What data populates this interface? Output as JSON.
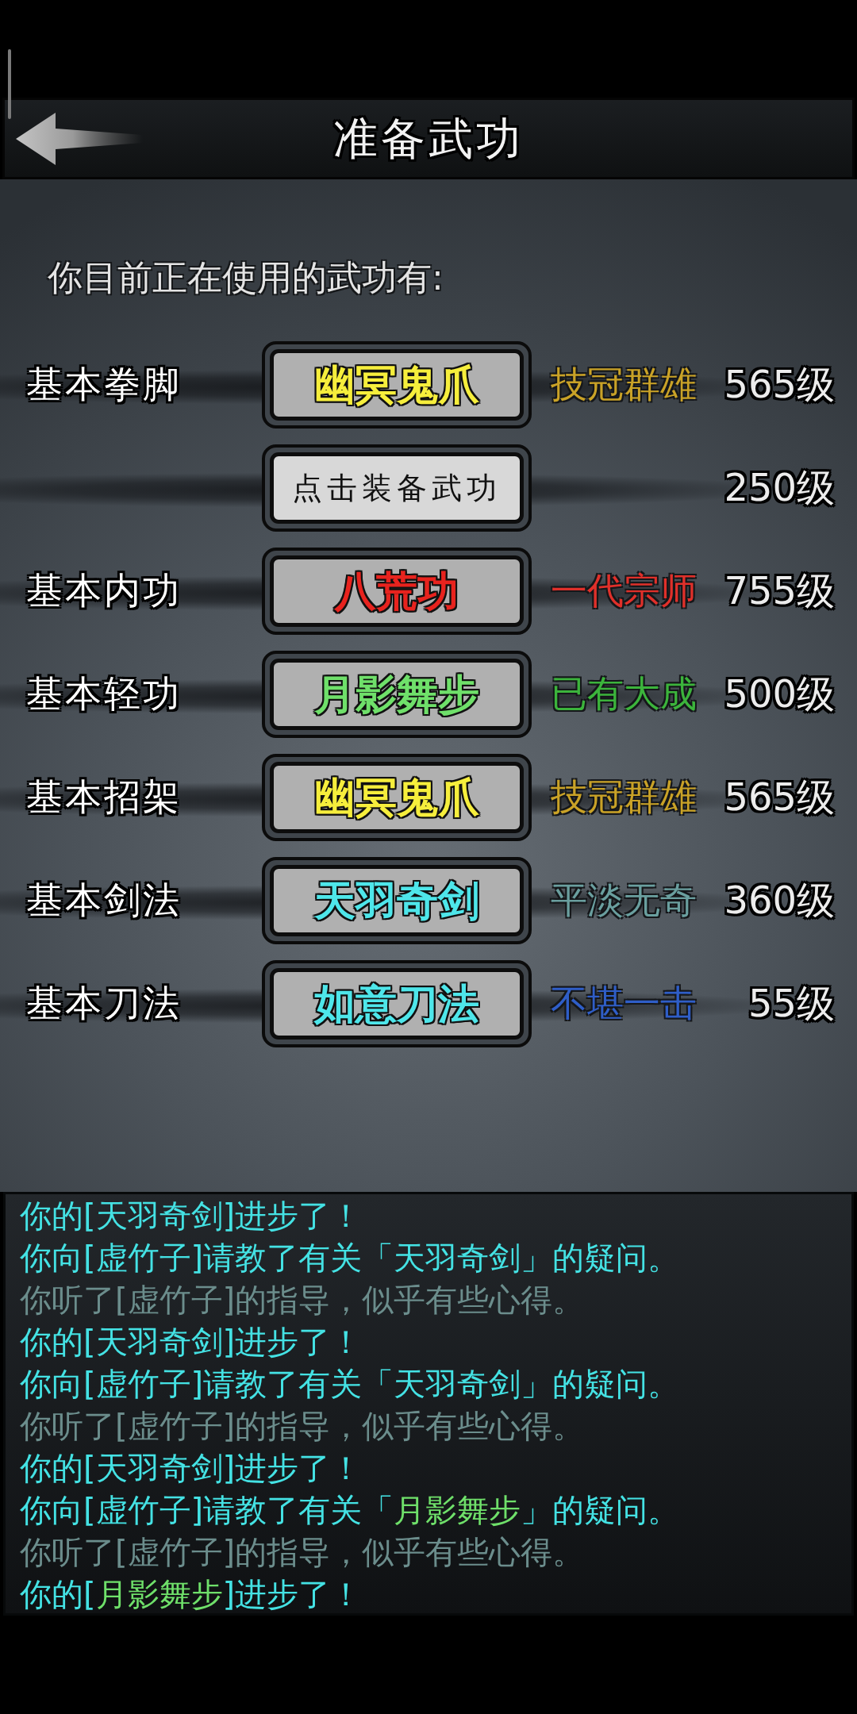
{
  "header": {
    "title": "准备武功"
  },
  "intro": "你目前正在使用的武功有:",
  "slots": [
    {
      "kind": "equipped",
      "category": "基本拳脚",
      "skill": {
        "name": "幽冥鬼爪",
        "color": "#f6ee3c"
      },
      "rank": {
        "text": "技冠群雄",
        "color": "#c9a227"
      },
      "level": "565级"
    },
    {
      "kind": "empty",
      "skill": {
        "name": "点击装备武功"
      },
      "level": "250级"
    },
    {
      "kind": "equipped",
      "category": "基本内功",
      "skill": {
        "name": "八荒功",
        "color": "#e8231e"
      },
      "rank": {
        "text": "一代宗师",
        "color": "#e0302a"
      },
      "level": "755级"
    },
    {
      "kind": "equipped",
      "category": "基本轻功",
      "skill": {
        "name": "月影舞步",
        "color": "#6fe06a"
      },
      "rank": {
        "text": "已有大成",
        "color": "#3cb43c"
      },
      "level": "500级"
    },
    {
      "kind": "equipped",
      "category": "基本招架",
      "skill": {
        "name": "幽冥鬼爪",
        "color": "#f6ee3c"
      },
      "rank": {
        "text": "技冠群雄",
        "color": "#c9a227"
      },
      "level": "565级"
    },
    {
      "kind": "equipped",
      "category": "基本剑法",
      "skill": {
        "name": "天羽奇剑",
        "color": "#4ee6ea"
      },
      "rank": {
        "text": "平淡无奇",
        "color": "#6a9f9f"
      },
      "level": "360级"
    },
    {
      "kind": "equipped",
      "category": "基本刀法",
      "skill": {
        "name": "如意刀法",
        "color": "#4ee6ea"
      },
      "rank": {
        "text": "不堪一击",
        "color": "#2f5ec8"
      },
      "level": "55级"
    }
  ],
  "log": [
    {
      "kind": "progress",
      "parts": [
        {
          "text": "你的[天羽奇剑]进步了！"
        }
      ]
    },
    {
      "kind": "ask",
      "parts": [
        {
          "text": "你向[虚竹子]请教了有关「天羽奇剑」的疑问。"
        }
      ]
    },
    {
      "kind": "listen",
      "parts": [
        {
          "text": "你听了[虚竹子]的指导，似乎有些心得。"
        }
      ]
    },
    {
      "kind": "progress",
      "parts": [
        {
          "text": "你的[天羽奇剑]进步了！"
        }
      ]
    },
    {
      "kind": "ask",
      "parts": [
        {
          "text": "你向[虚竹子]请教了有关「天羽奇剑」的疑问。"
        }
      ]
    },
    {
      "kind": "listen",
      "parts": [
        {
          "text": "你听了[虚竹子]的指导，似乎有些心得。"
        }
      ]
    },
    {
      "kind": "progress",
      "parts": [
        {
          "text": "你的[天羽奇剑]进步了！"
        }
      ]
    },
    {
      "kind": "ask",
      "parts": [
        {
          "text": "你向[虚竹子]请教了有关「"
        },
        {
          "text": "月影舞步",
          "color": "#6fe06a"
        },
        {
          "text": "」的疑问。"
        }
      ]
    },
    {
      "kind": "listen",
      "parts": [
        {
          "text": "你听了[虚竹子]的指导，似乎有些心得。"
        }
      ]
    },
    {
      "kind": "progress",
      "parts": [
        {
          "text": "你的["
        },
        {
          "text": "月影舞步",
          "color": "#6fe06a"
        },
        {
          "text": "]进步了！"
        }
      ]
    }
  ]
}
